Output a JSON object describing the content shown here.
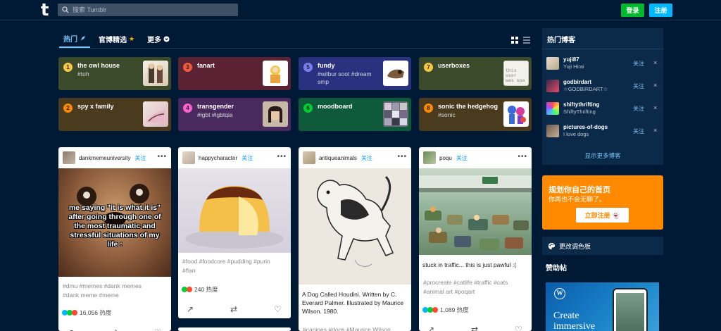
{
  "header": {
    "logo": "t",
    "search_placeholder": "搜索 Tumblr",
    "login_label": "登录",
    "signup_label": "注册"
  },
  "tabs": [
    {
      "label": "热门",
      "icon": "rocket-icon"
    },
    {
      "label": "官博精选",
      "icon": "star-icon",
      "glyph": "★"
    },
    {
      "label": "更多",
      "icon": "chevron-down-icon",
      "glyph": "⌄"
    }
  ],
  "tags": [
    {
      "num": "1",
      "name": "the owl house",
      "sub": "#toh",
      "color": "#3a4a2a",
      "badge": "#f7c744"
    },
    {
      "num": "3",
      "name": "fanart",
      "sub": "",
      "color": "#5a2233",
      "badge": "#f25a3e"
    },
    {
      "num": "5",
      "name": "fundy",
      "sub": "#wilbur soot #dream smp",
      "color": "#2a3280",
      "badge": "#7b7ef0"
    },
    {
      "num": "7",
      "name": "userboxes",
      "sub": "",
      "color": "#3a4a2a",
      "badge": "#f7c744"
    },
    {
      "num": "2",
      "name": "spy x family",
      "sub": "",
      "color": "#4a3a1e",
      "badge": "#ff8a00"
    },
    {
      "num": "4",
      "name": "transgender",
      "sub": "#lgbt #lgbtqia",
      "color": "#4a2a5e",
      "badge": "#ff62ce"
    },
    {
      "num": "6",
      "name": "moodboard",
      "sub": "",
      "color": "#0e5a3a",
      "badge": "#00cf35"
    },
    {
      "num": "8",
      "name": "sonic the hedgehog",
      "sub": "#sonic",
      "color": "#4a3a1e",
      "badge": "#ff8a00"
    }
  ],
  "thumb_text": "this user was spa",
  "posts": [
    {
      "user": "dankmemeuniversity",
      "follow": "关注",
      "more": "•••",
      "meme_text": "me saying \"it is what it is\" after going through one of the most traumatic and stressful situations of my life :",
      "tags_line1": "#dmu  #memes  #dank memes",
      "tags_line2": "#dank meme  #meme",
      "notes": "16,056 热度"
    },
    {
      "user": "happycharacter",
      "follow": "关注",
      "more": "•••",
      "tags_line1": "#food  #foodcore  #pudding  #purin",
      "tags_line2": "#flan",
      "notes": "240 热度"
    },
    {
      "user": "antiqueanimals",
      "follow": "关注",
      "more": "•••",
      "caption": "A Dog Called Houdini. Written by C. Everard Palmer. Illustrated by Maurice Wilson. 1980.",
      "tags_line1": "#canines  #dogs  #Maurice Wilson"
    },
    {
      "user": "poqu",
      "follow": "关注",
      "more": "•••",
      "caption": "stuck in traffic... this is just pawful :(",
      "tags_line1": "#procreate  #catlife  #traffic  #cats",
      "tags_line2": "#animal art  #poqart",
      "notes": "1,089 热度"
    }
  ],
  "sidebar": {
    "title": "热门博客",
    "bloggers": [
      {
        "name": "yuji87",
        "title": "Yuji Hirai",
        "follow": "关注",
        "close": "×"
      },
      {
        "name": "godbirdart",
        "title": "☆GODBIRDART☆",
        "follow": "关注",
        "close": "×"
      },
      {
        "name": "shiftythrifting",
        "title": "ShiftyThrifting",
        "follow": "关注",
        "close": "×"
      },
      {
        "name": "pictures-of-dogs",
        "title": "I love dogs",
        "follow": "关注",
        "close": "×"
      }
    ],
    "more": "显示更多博客"
  },
  "promo": {
    "title": "规划你自己的首页",
    "sub": "你再也不会无聊了。",
    "button": "立即注册"
  },
  "palette_label": "更改调色板",
  "sponsor": {
    "title": "赞助帖",
    "logo": "W",
    "text": "Create immersive"
  },
  "colors": {
    "background": "#001935",
    "accent": "#7cc3f7",
    "login": "#00b82e",
    "signup": "#00b8ff",
    "promo": "#ff8a00"
  }
}
